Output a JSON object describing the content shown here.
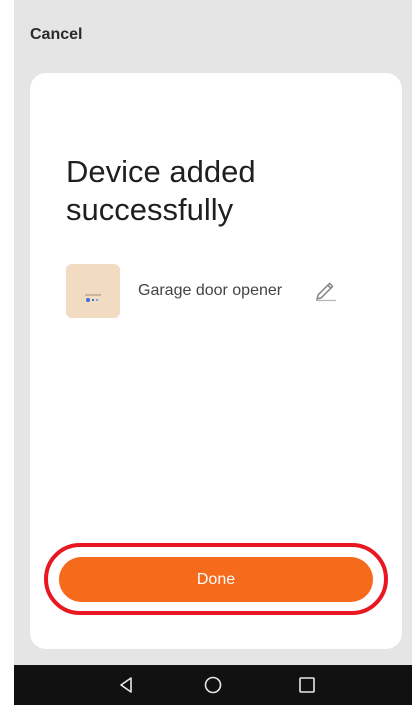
{
  "top_bar": {
    "cancel_label": "Cancel"
  },
  "card": {
    "title": "Device added successfully",
    "device": {
      "name": "Garage door opener",
      "thumbnail_icon": "device-thumbnail",
      "edit_icon": "pencil-icon"
    },
    "done_label": "Done"
  },
  "nav_bar": {
    "items": [
      {
        "icon": "back-triangle-icon"
      },
      {
        "icon": "home-circle-icon"
      },
      {
        "icon": "recents-square-icon"
      }
    ]
  },
  "colors": {
    "background": "#e5e5e5",
    "card": "#ffffff",
    "accent": "#f56a1b",
    "highlight": "#e81722",
    "nav_bar": "#111111"
  }
}
